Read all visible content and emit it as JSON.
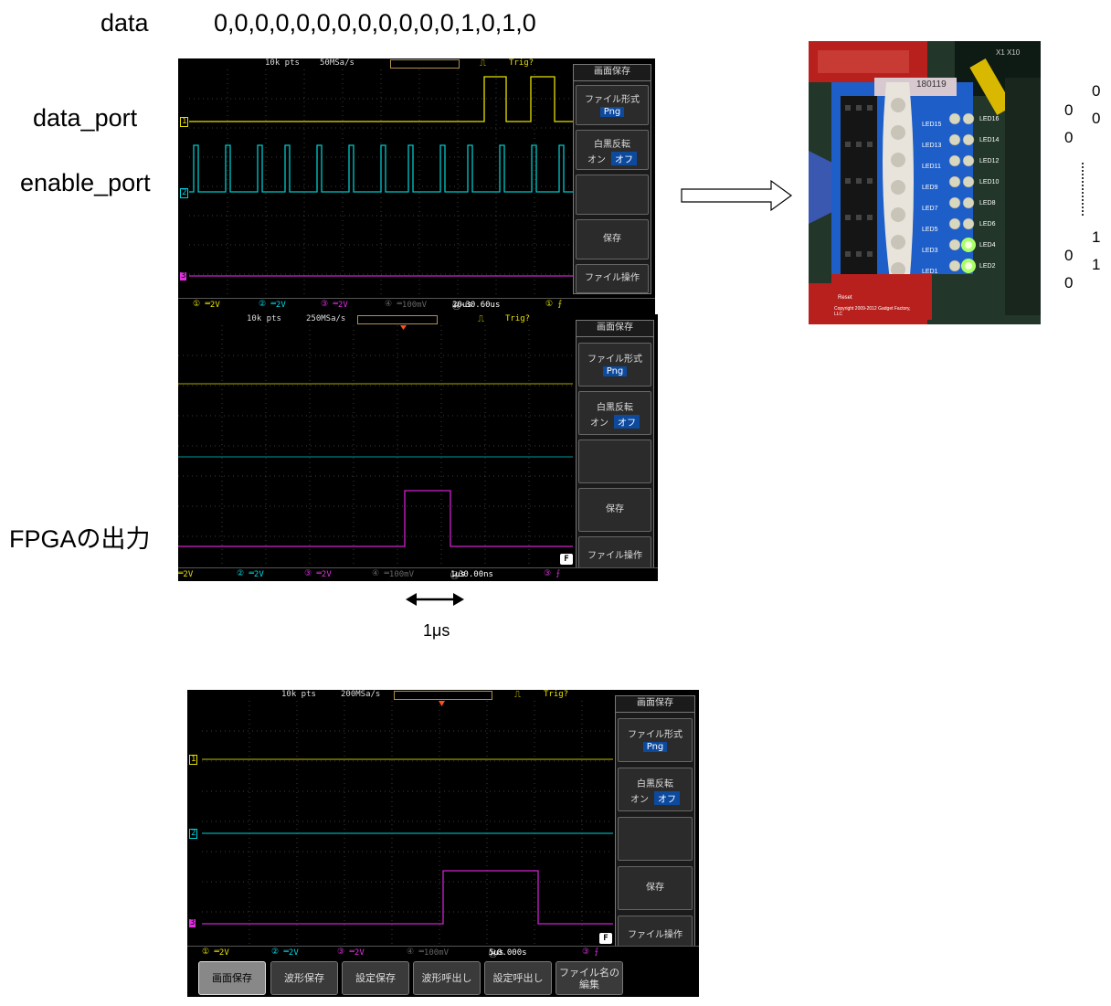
{
  "labels": {
    "data_title": "data",
    "data_sequence": "0,0,0,0,0,0,0,0,0,0,0,0,1,0,1,0",
    "data_port": "data_port",
    "enable_port": "enable_port",
    "fpga_output": "FPGAの出力",
    "one_us": "1μs"
  },
  "led_values": {
    "col_right": [
      "0",
      "0",
      "1",
      "1"
    ],
    "col_left": [
      "0",
      "0",
      "0",
      "0"
    ]
  },
  "scope1": {
    "points": "10k pts",
    "rate": "50MSa/s",
    "trig": "Trig?",
    "ch1": "1",
    "ch2": "2",
    "ch3": "3",
    "f_ch1": "2V",
    "f_ch2": "2V",
    "f_ch3": "2V",
    "f_ch4": "100mV",
    "timebase": "20us",
    "hpos": "-30.60us"
  },
  "scope2": {
    "points": "10k pts",
    "rate": "250MSa/s",
    "trig": "Trig?",
    "f_ch1": "2V",
    "f_ch2": "2V",
    "f_ch3": "2V",
    "f_ch4": "100mV",
    "timebase": "1us",
    "hpos": "30.00ns"
  },
  "scope3": {
    "points": "10k pts",
    "rate": "200MSa/s",
    "trig": "Trig?",
    "ch1": "1",
    "ch2": "2",
    "ch3": "3",
    "f_ch1": "2V",
    "f_ch2": "2V",
    "f_ch3": "2V",
    "f_ch4": "100mV",
    "timebase": "5us",
    "hpos": "0.000s"
  },
  "menu": {
    "title": "画面保存",
    "file_format": "ファイル形式",
    "png": "Png",
    "invert": "白黒反転",
    "on": "オン",
    "off": "オフ",
    "save": "保存",
    "file_ops": "ファイル操作",
    "f": "F"
  },
  "bottom_buttons": [
    "画面保存",
    "波形保存",
    "設定保存",
    "波形呼出し",
    "設定呼出し",
    "ファイル名の編集"
  ],
  "photo": {
    "tag": "180119",
    "leds_left": [
      "LED15",
      "LED13",
      "LED11",
      "LED9",
      "LED7",
      "LED5",
      "LED3",
      "LED1"
    ],
    "leds_right": [
      "LED16",
      "LED14",
      "LED12",
      "LED10",
      "LED8",
      "LED6",
      "LED4",
      "LED2"
    ],
    "reset": "Reset",
    "copyright": "Copyright 2009-2012 Gadget Factory, LLC",
    "probe": "X1 X10"
  },
  "colors": {
    "ch1": "#e8e000",
    "ch2": "#00d6e0",
    "ch3": "#e030e0",
    "grid": "#3c3c3c",
    "menu_highlight": "#0d4a9e"
  }
}
